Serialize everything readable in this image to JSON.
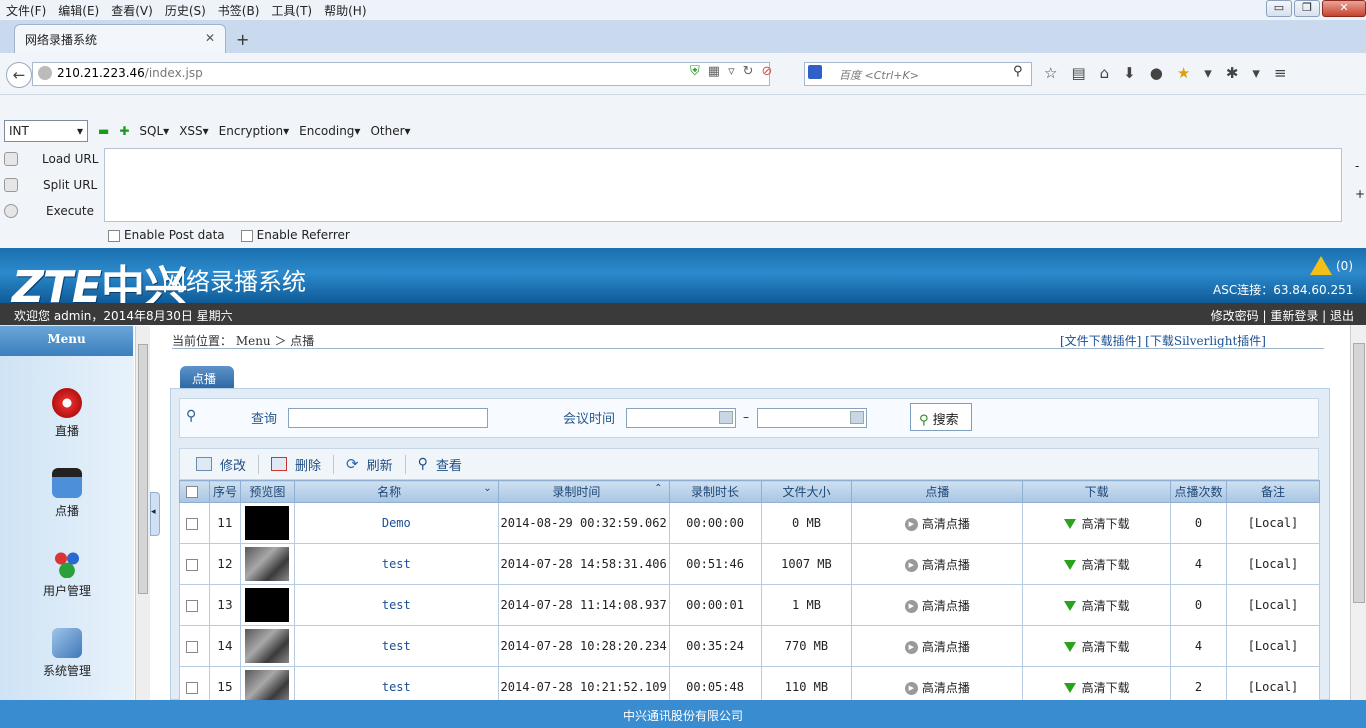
{
  "menubar": {
    "items": [
      "文件(F)",
      "编辑(E)",
      "查看(V)",
      "历史(S)",
      "书签(B)",
      "工具(T)",
      "帮助(H)"
    ]
  },
  "window": {
    "min": "▭",
    "max": "❐",
    "close": "✕"
  },
  "tab": {
    "title": "网络录播系统",
    "new": "+"
  },
  "address": {
    "host": "210.21.223.46",
    "path": "/index.jsp"
  },
  "search": {
    "engine": "百度",
    "placeholder": "百度 <Ctrl+K>"
  },
  "hackbar": {
    "type": "INT",
    "menus": [
      "SQL▾",
      "XSS▾",
      "Encryption▾",
      "Encoding▾",
      "Other▾"
    ],
    "buttons": [
      "Load URL",
      "Split URL",
      "Execute"
    ],
    "side": [
      "-",
      "+"
    ],
    "post": "Enable Post data",
    "referrer": "Enable Referrer"
  },
  "app": {
    "logo_en": "ZTE",
    "logo_cn": "中兴",
    "name": "网络录播系统",
    "alerts": "(0)",
    "asc": "ASC连接：63.84.60.251",
    "welcome": "欢迎您 admin，2014年8月30日 星期六",
    "user_links": "修改密码 | 重新登录 | 退出",
    "footer": "中兴通讯股份有限公司"
  },
  "menu": {
    "title": "Menu",
    "items": [
      "直播",
      "点播",
      "用户管理",
      "系统管理"
    ]
  },
  "content": {
    "breadcrumb": "当前位置： Menu ＞ 点播",
    "plugins": "[文件下载插件] [下载Silverlight插件]",
    "tab": "点播",
    "query_label": "查询",
    "time_label": "会议时间",
    "dash": "–",
    "search_button": "搜索",
    "toolbar": [
      "修改",
      "删除",
      "刷新",
      "查看"
    ]
  },
  "table": {
    "headers": [
      "序号",
      "预览图",
      "名称",
      "录制时间",
      "录制时长",
      "文件大小",
      "点播",
      "下载",
      "点播次数",
      "备注"
    ],
    "sort_name": "⌄",
    "sort_time": "⌃",
    "play": "高清点播",
    "download": "高清下载",
    "rows": [
      {
        "no": "11",
        "name": "Demo",
        "time": "2014-08-29 00:32:59.062",
        "duration": "00:00:00",
        "size": "0 MB",
        "count": "0",
        "note": "[Local]"
      },
      {
        "no": "12",
        "name": "test",
        "time": "2014-07-28 14:58:31.406",
        "duration": "00:51:46",
        "size": "1007 MB",
        "count": "4",
        "note": "[Local]"
      },
      {
        "no": "13",
        "name": "test",
        "time": "2014-07-28 11:14:08.937",
        "duration": "00:00:01",
        "size": "1 MB",
        "count": "0",
        "note": "[Local]"
      },
      {
        "no": "14",
        "name": "test",
        "time": "2014-07-28 10:28:20.234",
        "duration": "00:35:24",
        "size": "770 MB",
        "count": "4",
        "note": "[Local]"
      },
      {
        "no": "15",
        "name": "test",
        "time": "2014-07-28 10:21:52.109",
        "duration": "00:05:48",
        "size": "110 MB",
        "count": "2",
        "note": "[Local]"
      }
    ]
  }
}
